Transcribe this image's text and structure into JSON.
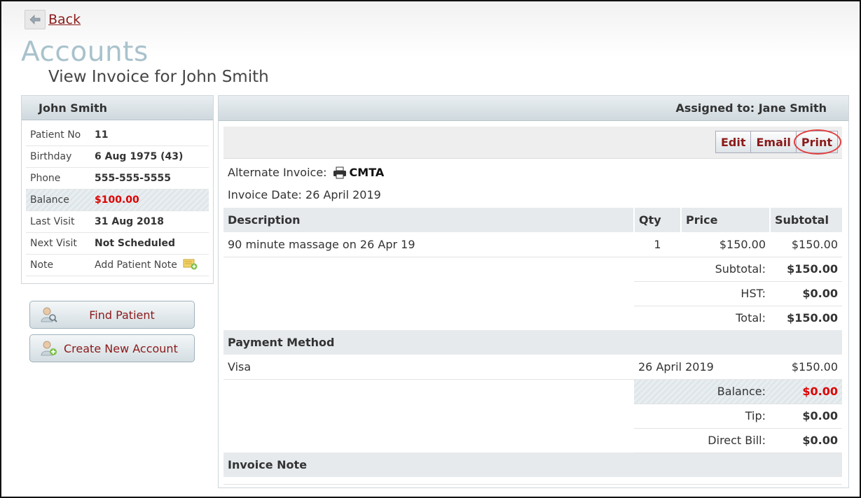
{
  "nav": {
    "back_label": "Back"
  },
  "page": {
    "title": "Accounts",
    "subtitle": "View Invoice for John Smith"
  },
  "patient": {
    "name": "John Smith",
    "rows": [
      {
        "label": "Patient No",
        "value": "11"
      },
      {
        "label": "Birthday",
        "value": "6 Aug 1975 (43)"
      },
      {
        "label": "Phone",
        "value": "555-555-5555"
      },
      {
        "label": "Balance",
        "value": "$100.00"
      },
      {
        "label": "Last Visit",
        "value": "31 Aug 2018"
      },
      {
        "label": "Next Visit",
        "value": "Not Scheduled"
      },
      {
        "label": "Note",
        "value": "Add Patient Note"
      }
    ]
  },
  "side_buttons": {
    "find": "Find Patient",
    "create": "Create New Account"
  },
  "invoice": {
    "assigned": "Assigned to: Jane Smith",
    "actions": {
      "edit": "Edit",
      "email": "Email",
      "print": "Print"
    },
    "alternate_label": "Alternate Invoice:",
    "alternate_value": "CMTA",
    "date_line": "Invoice Date: 26 April 2019",
    "columns": {
      "description": "Description",
      "qty": "Qty",
      "price": "Price",
      "subtotal": "Subtotal"
    },
    "items": [
      {
        "description": "90 minute massage on 26 Apr 19",
        "qty": "1",
        "price": "$150.00",
        "subtotal": "$150.00"
      }
    ],
    "totals": {
      "subtotal_label": "Subtotal:",
      "subtotal": "$150.00",
      "hst_label": "HST:",
      "hst": "$0.00",
      "total_label": "Total:",
      "total": "$150.00"
    },
    "payment": {
      "header": "Payment Method",
      "method": "Visa",
      "date": "26 April 2019",
      "amount": "$150.00",
      "balance_label": "Balance:",
      "balance": "$0.00",
      "tip_label": "Tip:",
      "tip": "$0.00",
      "direct_bill_label": "Direct Bill:",
      "direct_bill": "$0.00"
    },
    "note_header": "Invoice Note"
  },
  "colors": {
    "accent": "#8b1a1a",
    "title": "#a9c2cc",
    "alert": "#dd0000"
  }
}
